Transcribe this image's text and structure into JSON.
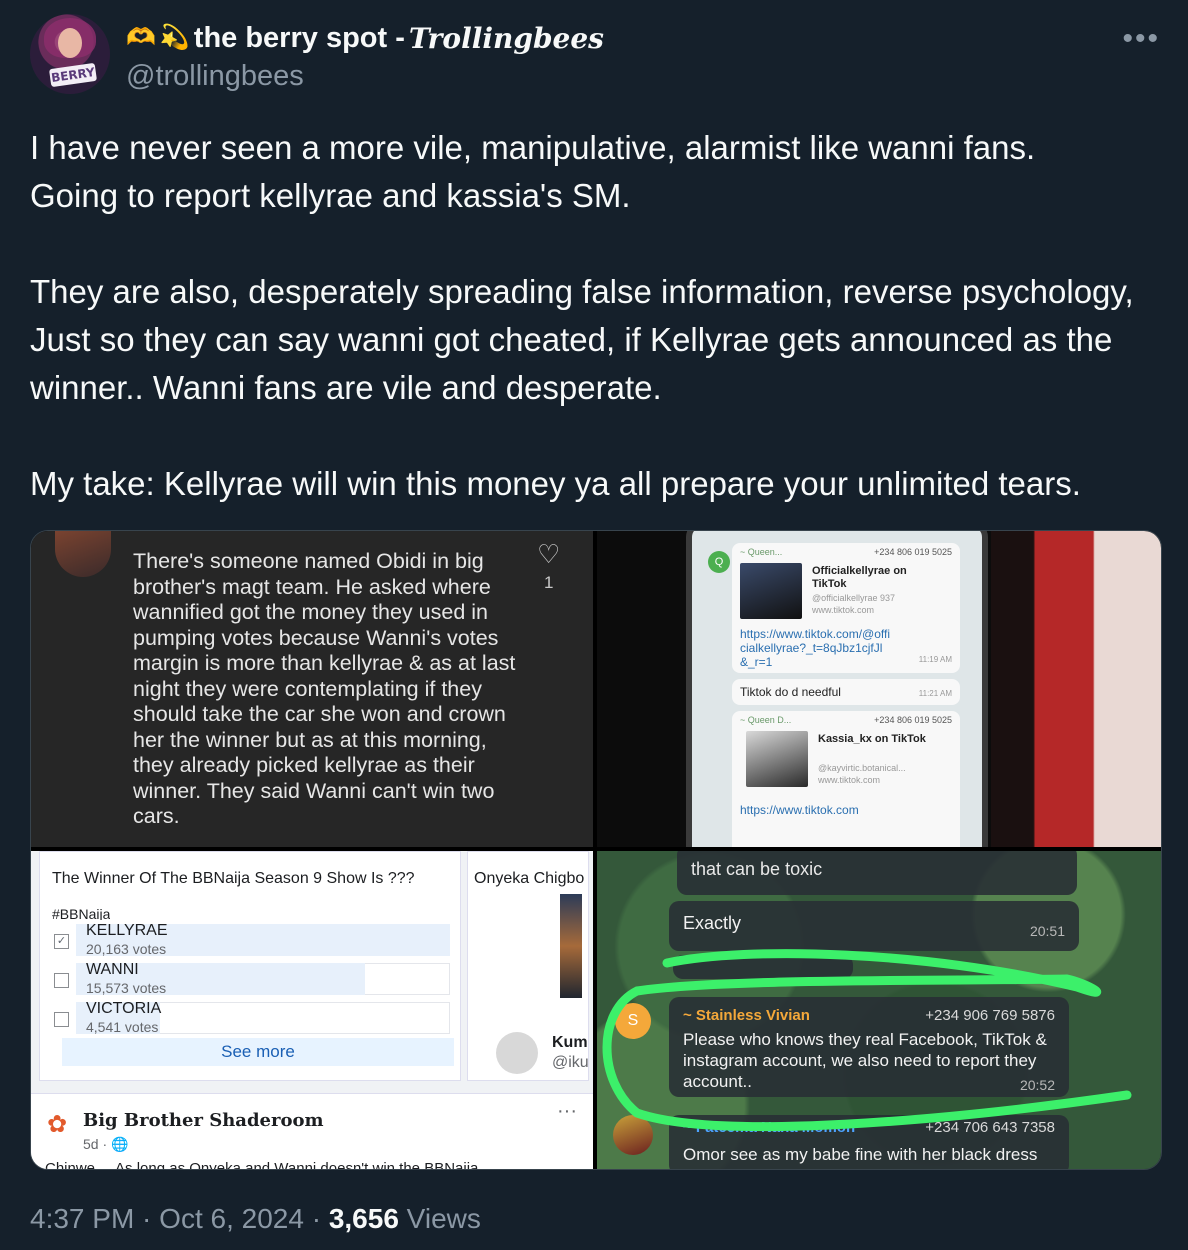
{
  "user": {
    "emoji_left": "🫶",
    "emoji_right": "💫",
    "display_name": "the berry spot - ",
    "display_name_script": "Trollingbees",
    "handle": "@trollingbees",
    "avatar_badge": "BERRY",
    "more_label": "•••"
  },
  "tweet": {
    "text": "I have never seen a more vile, manipulative, alarmist like wanni fans.\nGoing to report kellyrae and kassia's SM.\n\nThey are also, desperately spreading false information, reverse psychology,  Just so they can say wanni got cheated, if Kellyrae gets announced as the winner.. Wanni fans are vile and desperate.\n\nMy take: Kellyrae will win this money ya all prepare your unlimited tears."
  },
  "media": {
    "comment": {
      "text": "There's someone named Obidi in big brother's magt team. He asked where wannified got the money they used in pumping votes because Wanni's votes margin is more than kellyrae & as at last night they were contemplating if they should take the car she won and crown her the winner but as at this morning, they already picked kellyrae as their winner. They said Wanni can't win two cars.",
      "likes": "1"
    },
    "telegram": {
      "sender1": "~ Queen...",
      "phone1": "+234 806 019 5025",
      "card1_title": "Officialkellyrae on TikTok",
      "card1_sub": "@officialkellyrae 937",
      "card1_site": "www.tiktok.com",
      "link1": "https://www.tiktok.com/@officialkellyrae?_t=8qJbz1cjfJl&_r=1",
      "time1": "11:19 AM",
      "msg2": "Tiktok do d needful",
      "time2": "11:21 AM",
      "sender3": "~ Queen D...",
      "phone3": "+234 806 019 5025",
      "card3_title": "Kassia_kx on TikTok",
      "card3_sub": "@kayvirtic.botanical...",
      "card3_site": "www.tiktok.com",
      "link3": "https://www.tiktok.com"
    },
    "poll": {
      "question": "The Winner Of The BBNaija Season 9 Show Is ???",
      "tag": "#BBNaija",
      "options": [
        {
          "label": "KELLYRAE",
          "votes": "20,163 votes",
          "fraction": 1.0,
          "checked": true
        },
        {
          "label": "WANNI",
          "votes": "15,573 votes",
          "fraction": 0.772,
          "checked": false
        },
        {
          "label": "VICTORIA",
          "votes": "4,541 votes",
          "fraction": 0.225,
          "checked": false
        }
      ],
      "see_more": "See more",
      "side_name": "Onyeka Chigbo",
      "side_t1": "Kum",
      "side_t2": "@iku",
      "post_name": "Big Brother Shaderoom",
      "post_time": "5d · 🌐",
      "post_cut": "Chinwe ... As long as Onyeka and Wanni doesn't win the BBNaija"
    },
    "chat": {
      "msg1": "that can be toxic",
      "msg2": "Exactly",
      "time2": "20:51",
      "sender4": "~ Stainless Vivian",
      "phone4": "+234 906 769 5876",
      "avatar4": "S",
      "msg4": "Please who knows they real Facebook, TikTok & instagram account, we also need to report they account..",
      "time4": "20:52",
      "sender5": "~ Fateema Nana Momoh",
      "phone5": "+234 706 643 7358",
      "msg5": "Omor see as my babe fine with her black dress",
      "circle_color": "#3cf06a"
    }
  },
  "meta": {
    "time": "4:37 PM",
    "sep1": " · ",
    "date": "Oct 6, 2024",
    "sep2": " · ",
    "views": "3,656",
    "views_label": " Views"
  }
}
